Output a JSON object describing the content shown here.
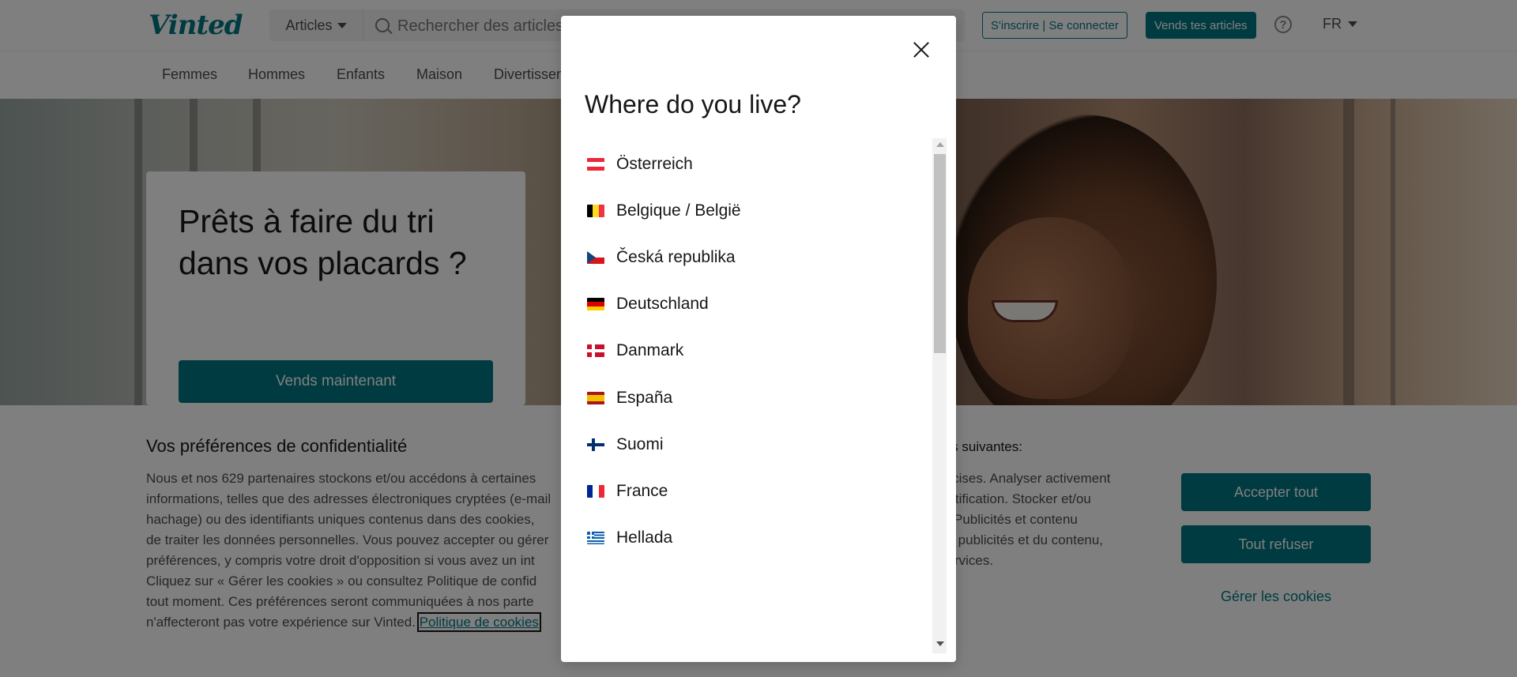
{
  "header": {
    "logo": "Vinted",
    "category_select": "Articles",
    "search_placeholder": "Rechercher des articles",
    "signup_label": "S'inscrire | Se connecter",
    "sell_label": "Vends tes articles",
    "help_icon": "question-circle-icon",
    "language": "FR"
  },
  "nav": {
    "items": [
      "Femmes",
      "Hommes",
      "Enfants",
      "Maison",
      "Divertissement"
    ]
  },
  "hero": {
    "title": "Prêts à faire du tri dans vos placards ?",
    "button": "Vends maintenant"
  },
  "cookie": {
    "title": "Vos préférences de confidentialité",
    "text_lines": [
      "Nous et nos 629 partenaires stockons et/ou accédons à certaines",
      "informations, telles que des adresses électroniques cryptées (e-mail",
      "hachage) ou des identifiants uniques contenus dans des cookies,",
      "de traiter les données personnelles. Vous pouvez accepter ou gérer",
      "préférences, y compris votre droit d'opposition si vous avez un int",
      "Cliquez sur « Gérer les cookies » ou consultez Politique de confid",
      "tout moment. Ces préférences seront communiquées à nos parte",
      "n'affecteront pas votre expérience sur Vinted."
    ],
    "link_label": "Politique de cookies",
    "right_title": "tés suivantes:",
    "right_lines": [
      "récises. Analyser activement",
      "entification. Stocker et/ou",
      "il. Publicités et contenu",
      "es publicités et du contenu,",
      "services."
    ],
    "accept_label": "Accepter tout",
    "refuse_label": "Tout refuser",
    "manage_label": "Gérer les cookies"
  },
  "modal": {
    "title": "Where do you live?",
    "close_icon": "close-icon",
    "countries": [
      {
        "name": "Österreich",
        "flag": "austria-flag-icon",
        "colors": [
          "#ed2939",
          "#ffffff",
          "#ed2939"
        ],
        "layout": "h"
      },
      {
        "name": "Belgique / België",
        "flag": "belgium-flag-icon",
        "colors": [
          "#000000",
          "#fdda24",
          "#ef3340"
        ],
        "layout": "v"
      },
      {
        "name": "Česká republika",
        "flag": "czech-flag-icon",
        "colors": [
          "#ffffff",
          "#d7141a",
          "#11457e"
        ],
        "layout": "cz"
      },
      {
        "name": "Deutschland",
        "flag": "germany-flag-icon",
        "colors": [
          "#000000",
          "#dd0000",
          "#ffce00"
        ],
        "layout": "h"
      },
      {
        "name": "Danmark",
        "flag": "denmark-flag-icon",
        "colors": [
          "#c8102e",
          "#ffffff"
        ],
        "layout": "nordic"
      },
      {
        "name": "España",
        "flag": "spain-flag-icon",
        "colors": [
          "#aa151b",
          "#f1bf00",
          "#aa151b"
        ],
        "layout": "es"
      },
      {
        "name": "Suomi",
        "flag": "finland-flag-icon",
        "colors": [
          "#ffffff",
          "#002f6c"
        ],
        "layout": "nordic"
      },
      {
        "name": "France",
        "flag": "france-flag-icon",
        "colors": [
          "#002395",
          "#ffffff",
          "#ed2939"
        ],
        "layout": "v"
      },
      {
        "name": "Hellada",
        "flag": "greece-flag-icon",
        "colors": [
          "#0d5eaf",
          "#ffffff"
        ],
        "layout": "gr"
      }
    ]
  }
}
